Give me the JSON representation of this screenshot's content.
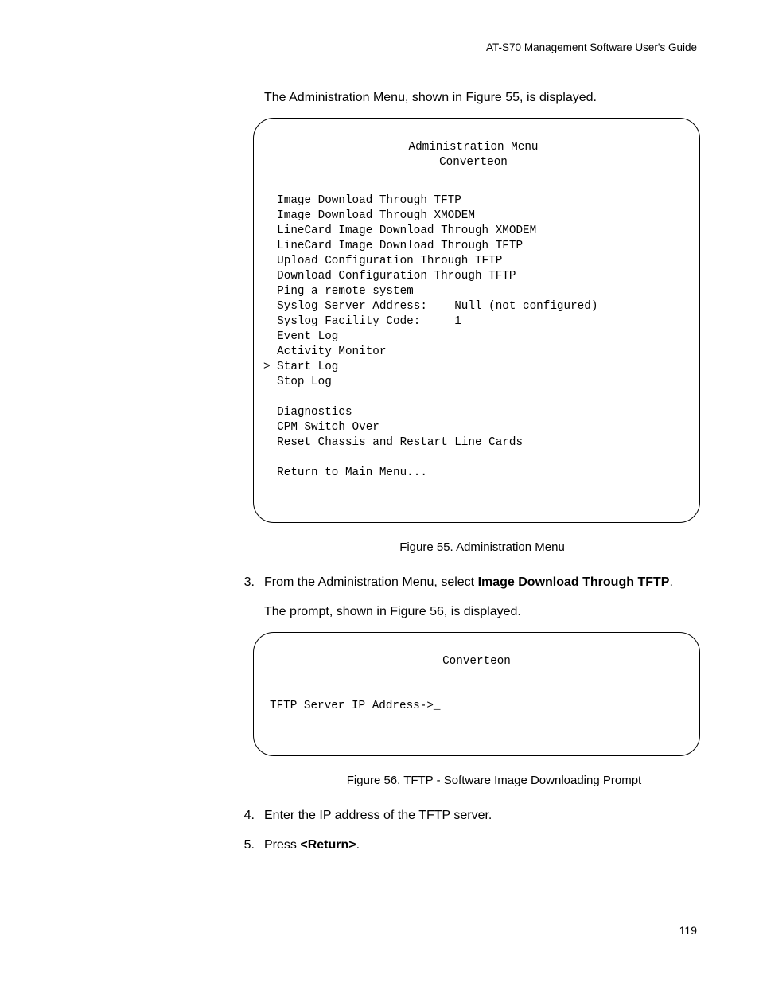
{
  "header": "AT-S70 Management Software User's Guide",
  "intro": "The Administration Menu, shown in Figure 55, is displayed.",
  "menu1": {
    "title": "Administration Menu",
    "subtitle": "Converteon",
    "body": "  Image Download Through TFTP\n  Image Download Through XMODEM\n  LineCard Image Download Through XMODEM\n  LineCard Image Download Through TFTP\n  Upload Configuration Through TFTP\n  Download Configuration Through TFTP\n  Ping a remote system\n  Syslog Server Address:    Null (not configured)\n  Syslog Facility Code:     1\n  Event Log\n  Activity Monitor\n> Start Log\n  Stop Log\n\n  Diagnostics\n  CPM Switch Over\n  Reset Chassis and Restart Line Cards\n\n  Return to Main Menu..."
  },
  "caption1": "Figure 55. Administration Menu",
  "step3": {
    "num": "3.",
    "pre": "From the Administration Menu, select ",
    "bold": "Image Download Through TFTP",
    "post": "."
  },
  "promptPara": "The prompt, shown in Figure 56, is displayed.",
  "menu2": {
    "title": "Converteon",
    "body": "TFTP Server IP Address->_"
  },
  "caption2": "Figure 56. TFTP - Software Image Downloading Prompt",
  "step4": {
    "num": "4.",
    "text": "Enter the IP address of the TFTP server."
  },
  "step5": {
    "num": "5.",
    "pre": "Press ",
    "bold": "<Return>",
    "post": "."
  },
  "pageNum": "119"
}
